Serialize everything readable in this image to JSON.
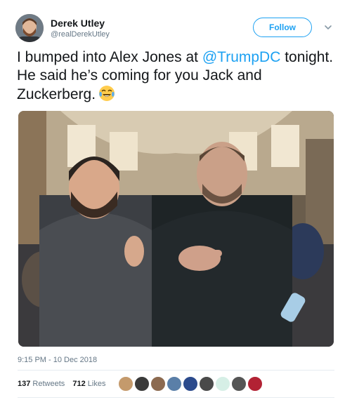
{
  "author": {
    "display_name": "Derek Utley",
    "handle": "@realDerekUtley"
  },
  "follow_label": "Follow",
  "tweet": {
    "text_part1": "I bumped into Alex Jones at ",
    "mention": "@TrumpDC",
    "text_part2": " tonight. He said he’s coming for you Jack and Zuckerberg.",
    "emoji": "face-with-tears-of-joy-icon"
  },
  "timestamp": "9:15 PM - 10 Dec 2018",
  "stats": {
    "retweets_count": "137",
    "retweets_label": "Retweets",
    "likes_count": "712",
    "likes_label": "Likes"
  },
  "likers": [
    {
      "color": "#c49a6c"
    },
    {
      "color": "#3a3a3a"
    },
    {
      "color": "#8c6a50"
    },
    {
      "color": "#5a7fa8"
    },
    {
      "color": "#2b4a8c"
    },
    {
      "color": "#4a4a4a"
    },
    {
      "color": "#d6efe6"
    },
    {
      "color": "#555555"
    },
    {
      "color": "#b22234"
    }
  ]
}
